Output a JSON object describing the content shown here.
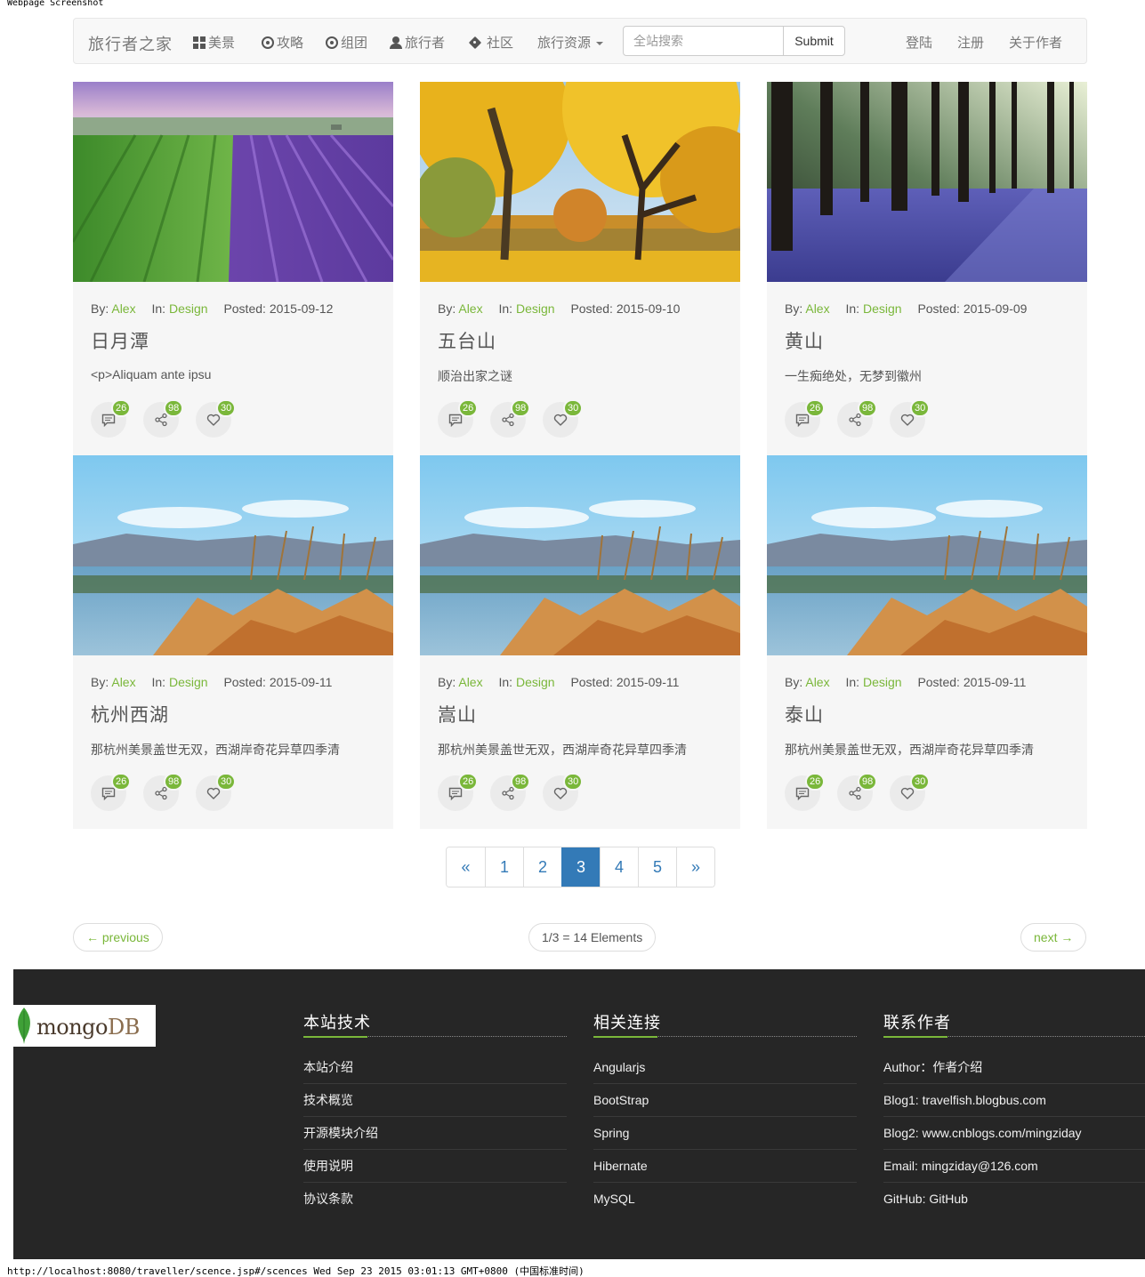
{
  "screenshot_header": "Webpage Screenshot",
  "navbar": {
    "brand": "旅行者之家",
    "items": [
      {
        "label": "美景",
        "icon": "grid-icon"
      },
      {
        "label": "攻略",
        "icon": "target-icon"
      },
      {
        "label": "组团",
        "icon": "target-icon"
      },
      {
        "label": "旅行者",
        "icon": "user-icon"
      },
      {
        "label": "社区",
        "icon": "tag-icon"
      },
      {
        "label": "旅行资源",
        "icon": "caret-down-icon"
      }
    ],
    "search_placeholder": "全站搜索",
    "search_button": "Submit",
    "right_links": [
      "登陆",
      "注册",
      "关于作者"
    ]
  },
  "cards": [
    {
      "author": "Alex",
      "category": "Design",
      "date": "2015-09-12",
      "title": "日月潭",
      "desc": "<p>Aliquam ante ipsu",
      "comments": "26",
      "shares": "98",
      "likes": "30"
    },
    {
      "author": "Alex",
      "category": "Design",
      "date": "2015-09-10",
      "title": "五台山",
      "desc": "顺治出家之谜",
      "comments": "26",
      "shares": "98",
      "likes": "30"
    },
    {
      "author": "Alex",
      "category": "Design",
      "date": "2015-09-09",
      "title": "黄山",
      "desc": "一生痴绝处，无梦到徽州",
      "comments": "26",
      "shares": "98",
      "likes": "30"
    },
    {
      "author": "Alex",
      "category": "Design",
      "date": "2015-09-11",
      "title": "杭州西湖",
      "desc": "那杭州美景盖世无双，西湖岸奇花异草四季清",
      "comments": "26",
      "shares": "98",
      "likes": "30"
    },
    {
      "author": "Alex",
      "category": "Design",
      "date": "2015-09-11",
      "title": "嵩山",
      "desc": "那杭州美景盖世无双，西湖岸奇花异草四季清",
      "comments": "26",
      "shares": "98",
      "likes": "30"
    },
    {
      "author": "Alex",
      "category": "Design",
      "date": "2015-09-11",
      "title": "泰山",
      "desc": "那杭州美景盖世无双，西湖岸奇花异草四季清",
      "comments": "26",
      "shares": "98",
      "likes": "30"
    }
  ],
  "labels": {
    "by": "By:",
    "in": "In:",
    "posted": "Posted:"
  },
  "pagination": {
    "prev": "«",
    "pages": [
      "1",
      "2",
      "3",
      "4",
      "5"
    ],
    "active": "3",
    "next": "»"
  },
  "pager": {
    "previous": "← previous",
    "status": "1/3 = 14 Elements",
    "next": "next →"
  },
  "footer": {
    "logo": {
      "mongo": "mongo",
      "db": "DB"
    },
    "columns": [
      {
        "title": "本站技术",
        "links": [
          "本站介绍",
          "技术概览",
          "开源模块介绍",
          "使用说明",
          "协议条款"
        ]
      },
      {
        "title": "相关连接",
        "links": [
          "Angularjs",
          "BootStrap",
          "Spring",
          "Hibernate",
          "MySQL"
        ]
      },
      {
        "title": "联系作者",
        "links": [
          "Author：作者介绍",
          "Blog1: travelfish.blogbus.com",
          "Blog2: www.cnblogs.com/mingziday",
          "Email: mingziday@126.com",
          "GitHub: GitHub"
        ]
      }
    ]
  },
  "screenshot_footer": "http://localhost:8080/traveller/scence.jsp#/scences Wed Sep 23 2015 03:01:13 GMT+0800 (中国标准时间)",
  "colors": {
    "accent_green": "#7ab73a",
    "pager_blue": "#337ab7",
    "footer_bg": "#262626"
  }
}
